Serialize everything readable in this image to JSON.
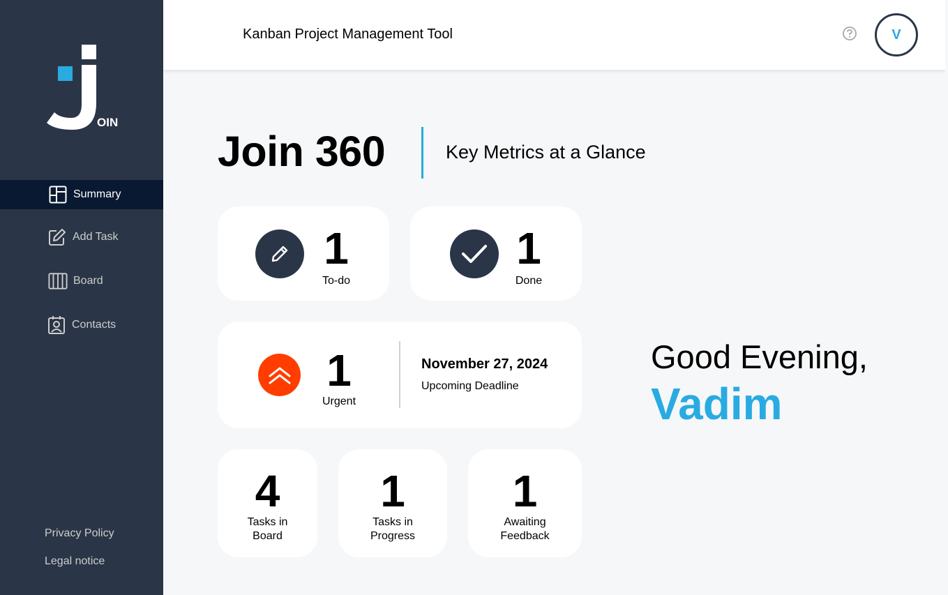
{
  "header": {
    "title": "Kanban Project Management Tool",
    "avatar_initial": "V"
  },
  "logo": {
    "text": "OIN"
  },
  "sidebar": {
    "items": [
      {
        "label": "Summary",
        "icon": "summary-icon",
        "active": true
      },
      {
        "label": "Add Task",
        "icon": "edit-icon",
        "active": false
      },
      {
        "label": "Board",
        "icon": "board-icon",
        "active": false
      },
      {
        "label": "Contacts",
        "icon": "contacts-icon",
        "active": false
      }
    ],
    "footer": {
      "privacy": "Privacy Policy",
      "legal": "Legal notice"
    }
  },
  "main": {
    "title": "Join 360",
    "subtitle": "Key Metrics at a Glance",
    "metrics": {
      "todo": {
        "value": "1",
        "label": "To-do"
      },
      "done": {
        "value": "1",
        "label": "Done"
      },
      "urgent": {
        "value": "1",
        "label": "Urgent"
      },
      "deadline": {
        "date": "November 27, 2024",
        "label": "Upcoming Deadline"
      },
      "board": {
        "value": "4",
        "label_line1": "Tasks in",
        "label_line2": "Board"
      },
      "progress": {
        "value": "1",
        "label_line1": "Tasks in",
        "label_line2": "Progress"
      },
      "feedback": {
        "value": "1",
        "label_line1": "Awaiting",
        "label_line2": "Feedback"
      }
    },
    "greeting": {
      "text": "Good Evening,",
      "name": "Vadim"
    }
  },
  "colors": {
    "sidebar": "#2a3647",
    "active": "#091931",
    "accent": "#29abe2",
    "urgent": "#ff3d00"
  }
}
